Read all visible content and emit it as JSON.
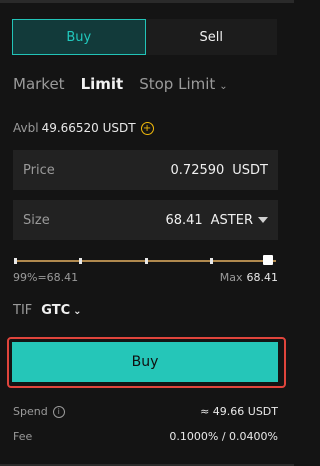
{
  "side_toggle": {
    "buy_label": "Buy",
    "sell_label": "Sell",
    "active": "buy"
  },
  "order_types": [
    {
      "label": "Market"
    },
    {
      "label": "Limit",
      "active": true
    },
    {
      "label": "Stop Limit"
    }
  ],
  "available": {
    "label": "Avbl",
    "value": "49.66520 USDT"
  },
  "price": {
    "label": "Price",
    "value": "0.72590",
    "unit": "USDT"
  },
  "size": {
    "label": "Size",
    "value": "68.41",
    "unit": "ASTER"
  },
  "slider": {
    "left_label": "99%=68.41",
    "max_label": "Max",
    "max_value": "68.41",
    "percent": 0.99
  },
  "tif": {
    "label": "TIF",
    "value": "GTC"
  },
  "buy_button": {
    "label": "Buy"
  },
  "spend": {
    "label": "Spend",
    "value": "≈ 49.66 USDT"
  },
  "fee": {
    "label": "Fee",
    "value": "0.1000% / 0.0400%"
  },
  "colors": {
    "accent": "#25c6b8",
    "highlight_border": "#e0453c",
    "slider_track": "#b0894e",
    "available_icon": "#f0b90b"
  }
}
